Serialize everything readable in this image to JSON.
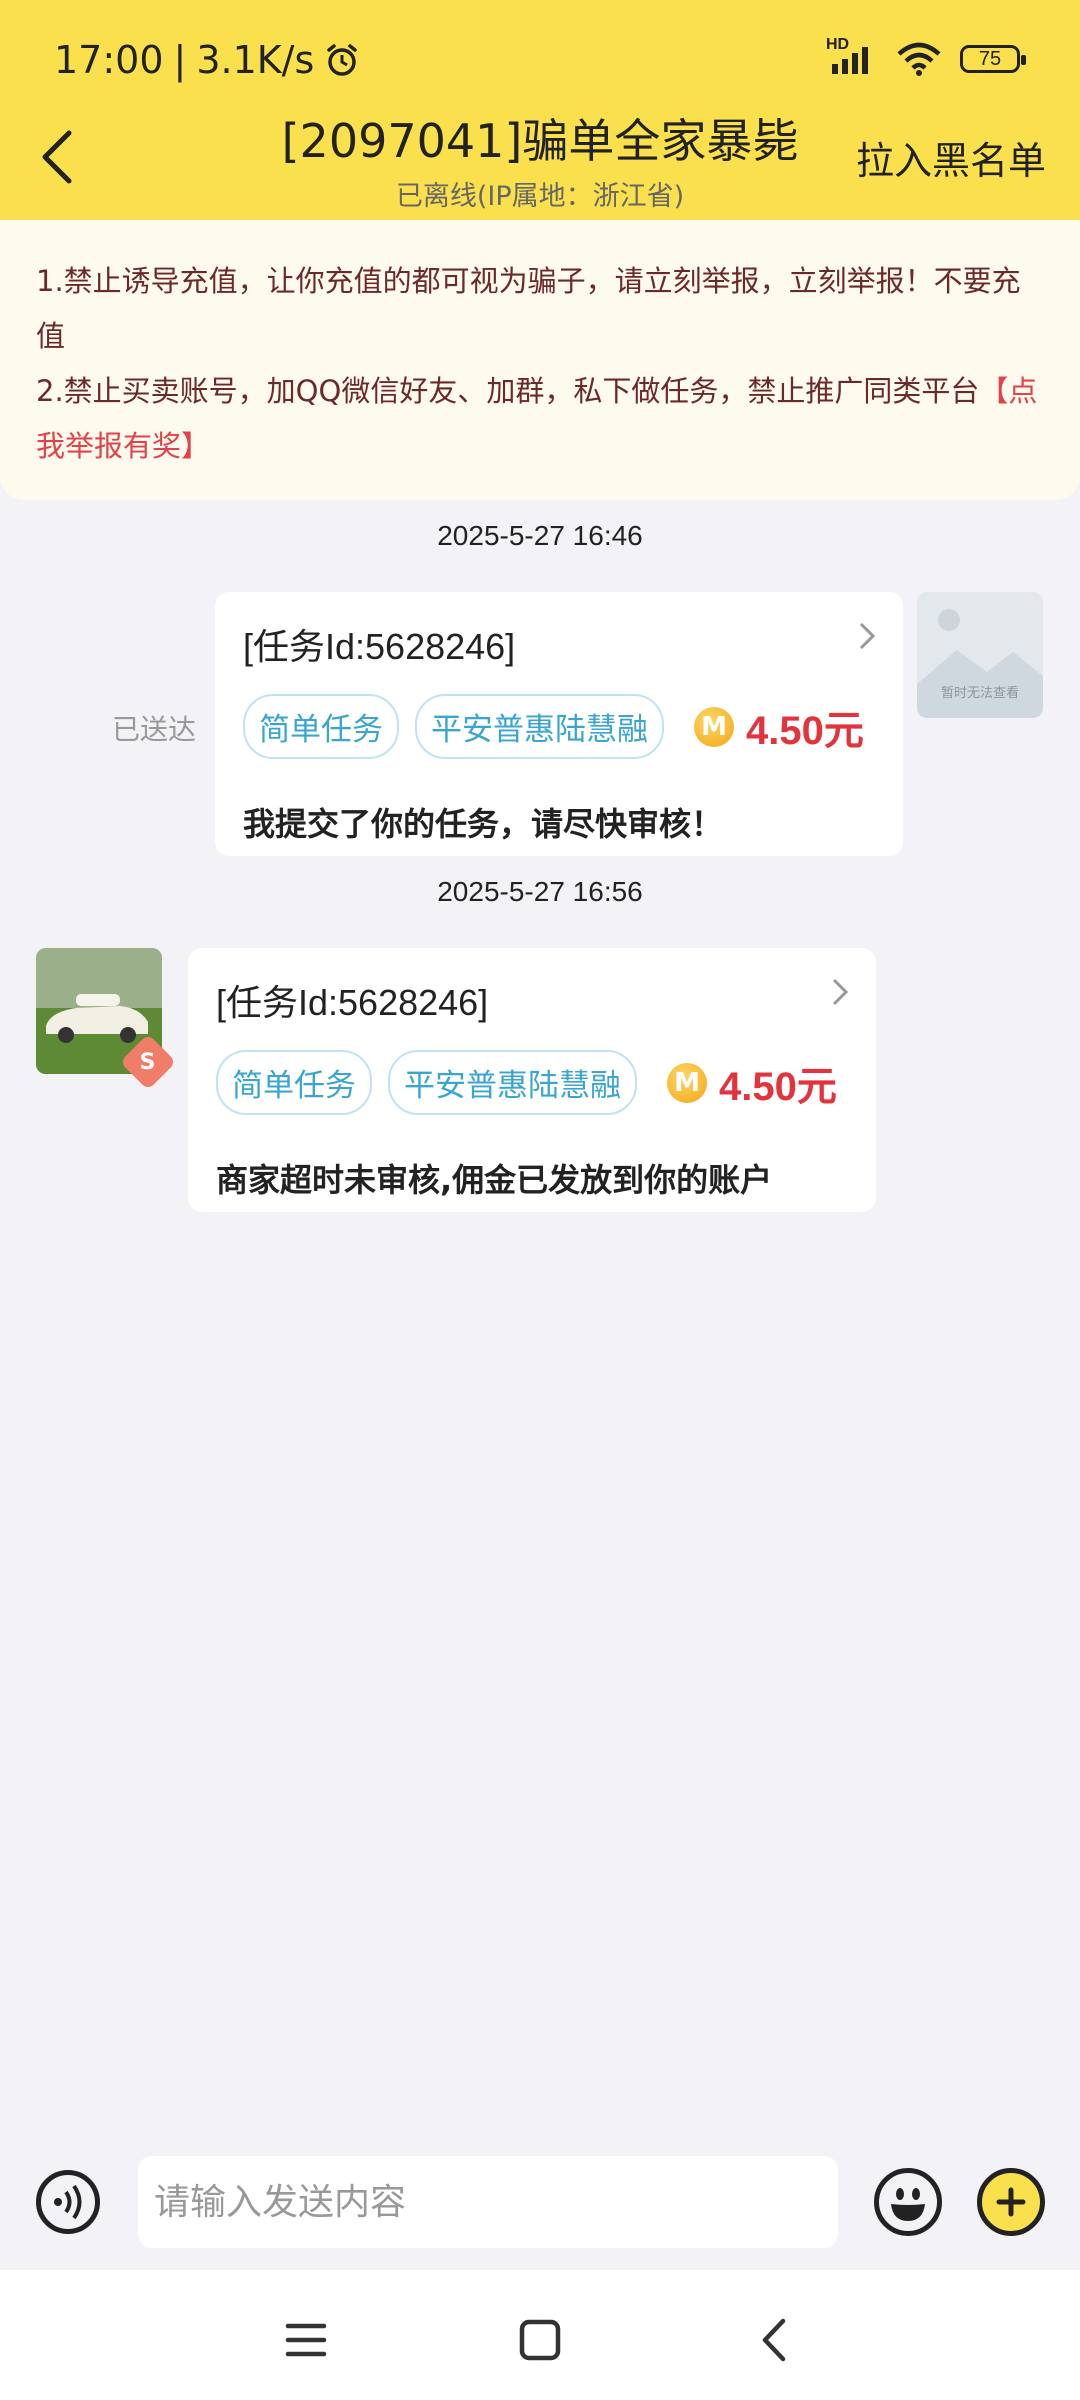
{
  "status": {
    "time": "17:00",
    "network_speed": "3.1K/s",
    "network_type": "HD",
    "battery": "75",
    "icons": [
      "alarm-icon",
      "signal-icon",
      "wifi-icon",
      "battery-icon"
    ]
  },
  "header": {
    "title": "[2097041]骗单全家暴毙",
    "subtitle": "已离线(IP属地：浙江省)",
    "blacklist_label": "拉入黑名单"
  },
  "notice": {
    "line1": "1.禁止诱导充值，让你充值的都可视为骗子，请立刻举报，立刻举报！不要充值",
    "line2": "2.禁止买卖账号，加QQ微信好友、加群，私下做任务，禁止推广同类平台",
    "report_link": "【点我举报有奖】"
  },
  "messages": [
    {
      "timestamp": "2025-5-27 16:46",
      "task_id": "[任务Id:5628246]",
      "tags": [
        "简单任务",
        "平安普惠陆慧融"
      ],
      "coin": "M",
      "price": "4.50元",
      "text": "我提交了你的任务，请尽快审核！",
      "status": "已送达",
      "avatar_text": "暂时无法查看"
    },
    {
      "timestamp": "2025-5-27 16:56",
      "task_id": "[任务Id:5628246]",
      "tags": [
        "简单任务",
        "平安普惠陆慧融"
      ],
      "coin": "M",
      "price": "4.50元",
      "text": "商家超时未审核,佣金已发放到你的账户",
      "badge": "S"
    }
  ],
  "input": {
    "placeholder": "请输入发送内容"
  },
  "colors": {
    "header_bg": "#fbe04e",
    "notice_bg": "#fffaee",
    "price": "#e2343c",
    "tag": "#3aa6d0",
    "link": "#e2434a"
  }
}
